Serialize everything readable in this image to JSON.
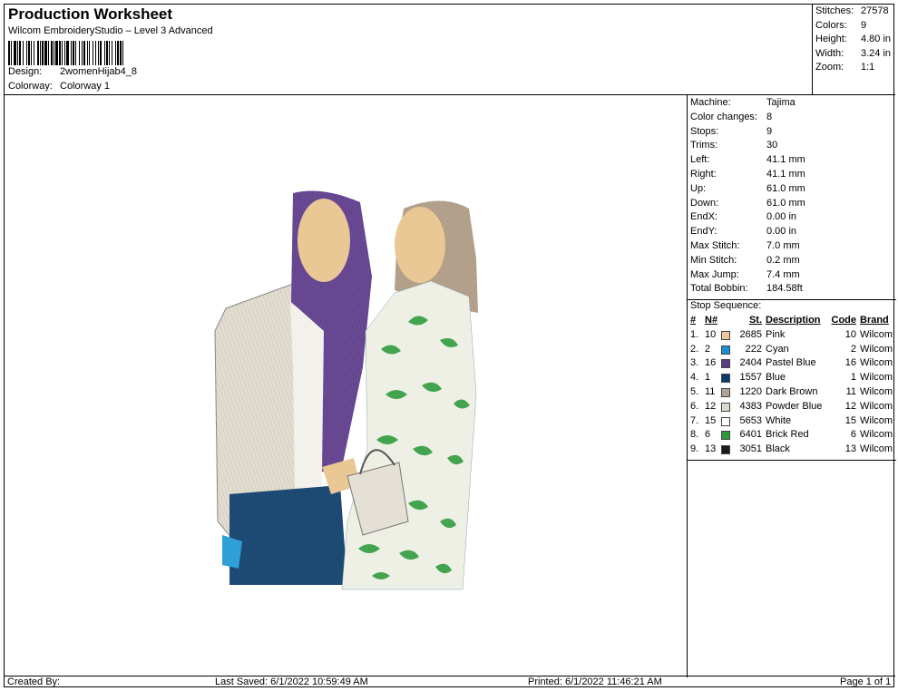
{
  "header": {
    "title": "Production Worksheet",
    "subtitle": "Wilcom EmbroideryStudio – Level 3 Advanced",
    "design_label": "Design:",
    "design_value": "2womenHijab4_8",
    "colorway_label": "Colorway:",
    "colorway_value": "Colorway 1"
  },
  "stats_top": [
    {
      "label": "Stitches:",
      "value": "27578"
    },
    {
      "label": "Colors:",
      "value": "9"
    },
    {
      "label": "Height:",
      "value": "4.80 in"
    },
    {
      "label": "Width:",
      "value": "3.24 in"
    },
    {
      "label": "Zoom:",
      "value": "1:1"
    }
  ],
  "machine_info": [
    {
      "label": "Machine:",
      "value": "Tajima"
    },
    {
      "label": "Color changes:",
      "value": "8"
    },
    {
      "label": "Stops:",
      "value": "9"
    },
    {
      "label": "Trims:",
      "value": "30"
    },
    {
      "label": "Left:",
      "value": "41.1 mm"
    },
    {
      "label": "Right:",
      "value": "41.1 mm"
    },
    {
      "label": "Up:",
      "value": "61.0 mm"
    },
    {
      "label": "Down:",
      "value": "61.0 mm"
    },
    {
      "label": "EndX:",
      "value": "0.00 in"
    },
    {
      "label": "EndY:",
      "value": "0.00 in"
    },
    {
      "label": "Max Stitch:",
      "value": "7.0 mm"
    },
    {
      "label": "Min Stitch:",
      "value": "0.2 mm"
    },
    {
      "label": "Max Jump:",
      "value": "7.4 mm"
    },
    {
      "label": "Total Bobbin:",
      "value": "184.58ft"
    }
  ],
  "stop_sequence": {
    "title": "Stop Sequence:",
    "headers": {
      "idx": "#",
      "n": "N#",
      "st": "St.",
      "description": "Description",
      "code": "Code",
      "brand": "Brand"
    },
    "rows": [
      {
        "idx": "1.",
        "n": "10",
        "st": "2685",
        "description": "Pink",
        "code": "10",
        "brand": "Wilcom",
        "color": "#f2c49c"
      },
      {
        "idx": "2.",
        "n": "2",
        "st": "222",
        "description": "Cyan",
        "code": "2",
        "brand": "Wilcom",
        "color": "#1b8fd0"
      },
      {
        "idx": "3.",
        "n": "16",
        "st": "2404",
        "description": "Pastel Blue",
        "code": "16",
        "brand": "Wilcom",
        "color": "#5c3a86"
      },
      {
        "idx": "4.",
        "n": "1",
        "st": "1557",
        "description": "Blue",
        "code": "1",
        "brand": "Wilcom",
        "color": "#0c3a6a"
      },
      {
        "idx": "5.",
        "n": "11",
        "st": "1220",
        "description": "Dark Brown",
        "code": "11",
        "brand": "Wilcom",
        "color": "#b3a293"
      },
      {
        "idx": "6.",
        "n": "12",
        "st": "4383",
        "description": "Powder Blue",
        "code": "12",
        "brand": "Wilcom",
        "color": "#dcd8cd"
      },
      {
        "idx": "7.",
        "n": "15",
        "st": "5653",
        "description": "White",
        "code": "15",
        "brand": "Wilcom",
        "color": "#ffffff"
      },
      {
        "idx": "8.",
        "n": "6",
        "st": "6401",
        "description": "Brick Red",
        "code": "6",
        "brand": "Wilcom",
        "color": "#2f9a3a"
      },
      {
        "idx": "9.",
        "n": "13",
        "st": "3051",
        "description": "Black",
        "code": "13",
        "brand": "Wilcom",
        "color": "#1a1a1a"
      }
    ]
  },
  "footer": {
    "created_by": "Created By:",
    "last_saved": "Last Saved: 6/1/2022 10:59:49 AM",
    "printed": "Printed: 6/1/2022 11:46:21 AM",
    "page": "Page 1 of 1"
  }
}
